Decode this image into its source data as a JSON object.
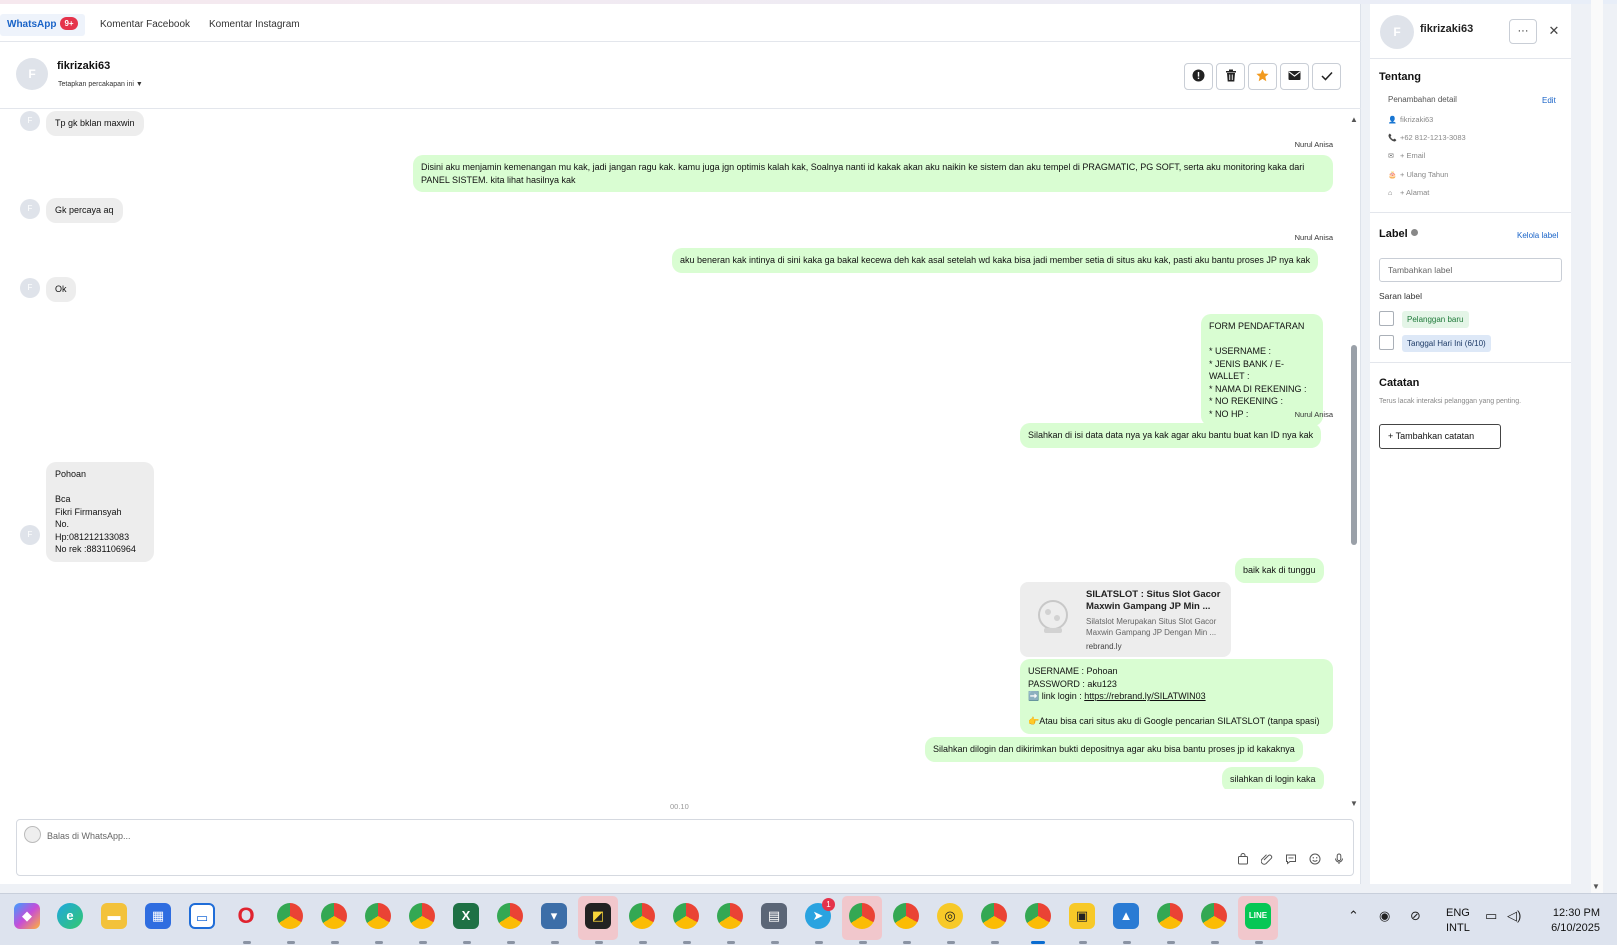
{
  "tabs": [
    {
      "label": "WhatsApp",
      "badge": "9+"
    },
    {
      "label": "Komentar Facebook"
    },
    {
      "label": "Komentar Instagram"
    }
  ],
  "header": {
    "avatar_letter": "F",
    "name": "fikrizaki63",
    "pin_label": "Tetapkan percakapan ini"
  },
  "header_buttons": [
    "info-icon",
    "trash-icon",
    "star-icon",
    "mail-icon",
    "check-icon"
  ],
  "messages": {
    "m1": "Tp gk bklan maxwin",
    "s1": "Nurul Anisa",
    "m2": "Disini aku menjamin kemenangan mu kak, jadi jangan ragu kak. kamu juga jgn optimis kalah kak, Soalnya nanti id kakak akan aku naikin ke sistem dan aku tempel di PRAGMATIC, PG SOFT, serta aku monitoring kaka dari\nPANEL  SISTEM. kita lihat hasilnya kak",
    "m3": "Gk percaya aq",
    "s2": "Nurul Anisa",
    "m4": "aku beneran kak intinya di sini kaka ga bakal kecewa deh kak asal setelah wd kaka bisa jadi member setia di situs aku kak, pasti aku bantu proses JP nya kak",
    "m5": "Ok",
    "m6": " FORM PENDAFTARAN\n\n* USERNAME :\n* JENIS BANK / E-WALLET :\n* NAMA DI REKENING :\n* NO REKENING :\n* NO HP :",
    "s3": "Nurul Anisa",
    "m7": "Silahkan di isi data data nya ya kak agar aku bantu buat kan ID nya kak",
    "m8": "Pohoan\n\nBca\nFikri Firmansyah\nNo. Hp:081212133083\nNo rek :8831106964",
    "m9": "baik kak di tunggu",
    "link_title": "SILATSLOT : Situs Slot Gacor Maxwin Gampang JP Min ...",
    "link_desc": "Silatslot Merupakan Situs Slot Gacor Maxwin Gampang JP Dengan Min ...",
    "link_domain": "rebrand.ly",
    "m10_a": "USERNAME : Pohoan\nPASSWORD : aku123\n➡️ link login : ",
    "m10_link": "https://rebrand.ly/SILATWIN03",
    "m10_b": "👉Atau bisa cari situs aku di Google pencarian SILATSLOT (tanpa spasi)",
    "m11": "Silahkan dilogin dan dikirimkan bukti depositnya agar aku bisa bantu proses jp id kakaknya",
    "m12": "silahkan di login kaka",
    "in_avatar_letter": "F"
  },
  "timeline": "00.10",
  "composer": {
    "placeholder": "Balas di WhatsApp..."
  },
  "side": {
    "avatar_letter": "F",
    "name": "fikrizaki63",
    "about_title": "Tentang",
    "add_detail": "Penambahan detail",
    "edit": "Edit",
    "details": [
      {
        "icon": "user-icon",
        "value": "fikrizaki63"
      },
      {
        "icon": "phone-icon",
        "value": "+62 812-1213-3083"
      },
      {
        "icon": "mail-icon",
        "value": "+ Email"
      },
      {
        "icon": "cake-icon",
        "value": "+ Ulang Tahun"
      },
      {
        "icon": "home-icon",
        "value": "+ Alamat"
      }
    ],
    "label_title": "Label",
    "label_manage": "Kelola label",
    "label_placeholder": "Tambahkan label",
    "label_suggest": "Saran label",
    "suggestions": [
      "Pelanggan baru",
      "Tanggal Hari Ini (6/10)"
    ],
    "notes_title": "Catatan",
    "notes_desc": "Terus lacak interaksi pelanggan yang penting.",
    "add_note": "Tambahkan catatan"
  },
  "taskbar": {
    "lang_line1": "ENG",
    "lang_line2": "INTL",
    "time": "12:30 PM",
    "date": "6/10/2025",
    "telegram_badge": "1"
  },
  "colors": {
    "accent": "#1a64c8",
    "outgoing_bubble": "#d9fdd2",
    "incoming_bubble": "#ededed",
    "badge": "#e5334b"
  }
}
